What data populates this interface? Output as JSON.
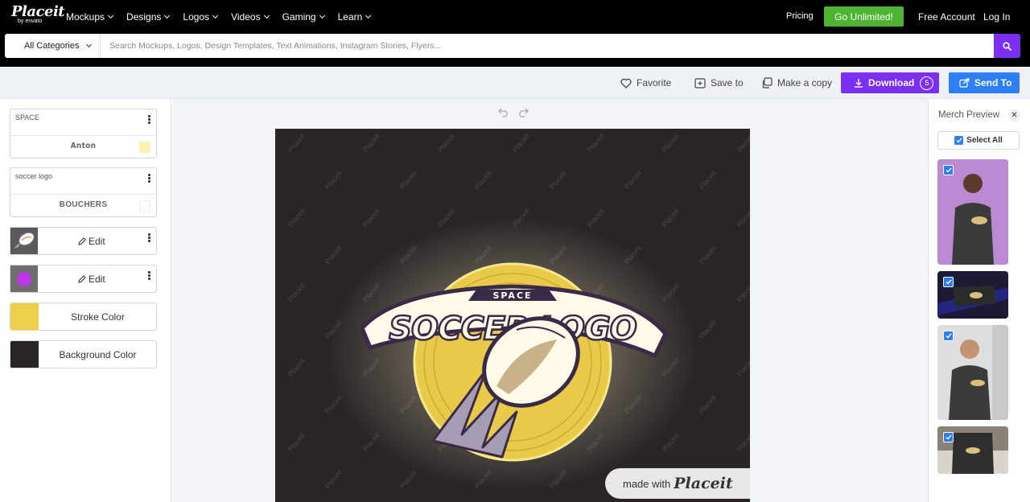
{
  "nav": {
    "logo": "Placeit",
    "logo_sub": "by envato",
    "menu": [
      "Mockups",
      "Designs",
      "Logos",
      "Videos",
      "Gaming",
      "Learn"
    ],
    "pricing": "Pricing",
    "go_unlimited": "Go Unlimited!",
    "free_account": "Free Account",
    "login": "Log In"
  },
  "search": {
    "category": "All Categories",
    "placeholder": "Search Mockups, Logos, Design Templates, Text Animations, Instagram Stories, Flyers..."
  },
  "actions": {
    "favorite": "Favorite",
    "save_to": "Save to",
    "make_copy": "Make a copy",
    "download": "Download",
    "download_count": "5",
    "send_to": "Send To"
  },
  "left_panel": {
    "text_layers": [
      {
        "label": "SPACE",
        "font": "Anton",
        "swatch": "#fbf1b0"
      },
      {
        "label": "soccer logo",
        "font": "BOUCHERS",
        "swatch": "#ffffff"
      }
    ],
    "edit_label": "Edit",
    "colors": [
      {
        "name": "Stroke Color",
        "color": "#efcf4a"
      },
      {
        "name": "Background Color",
        "color": "#2a2428"
      }
    ]
  },
  "canvas": {
    "logo_top_text": "SPACE",
    "logo_main_text": "SOCCER LOGO",
    "watermark": "Placeit",
    "made_with": "made with",
    "made_with_brand": "Placeit"
  },
  "merch": {
    "title": "Merch Preview",
    "select_all": "Select All"
  },
  "colors": {
    "purple": "#7b2ff2",
    "blue": "#2d7ff9",
    "green": "#4fb332",
    "yellow": "#efcf4a",
    "dark_bg": "#2a2428"
  }
}
